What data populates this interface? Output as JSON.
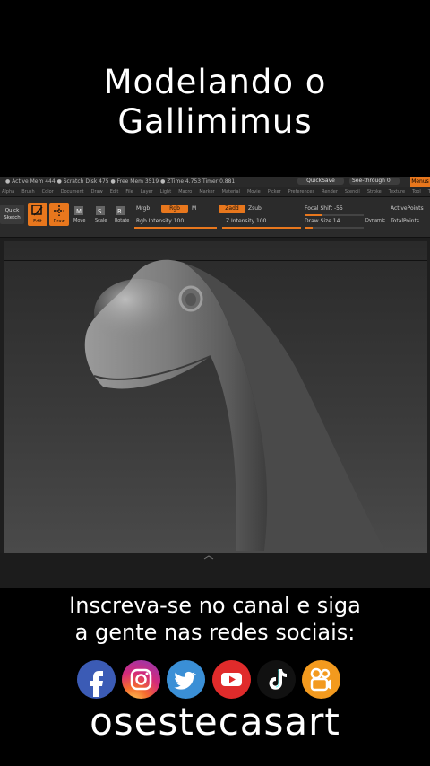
{
  "title": {
    "line1": "Modelando o",
    "line2": "Gallimimus"
  },
  "zbrush": {
    "status_info": "● Active Mem 444 ● Scratch Disk 475 ● Free Mem 3519 ● ZTime 4.753 Timer 0.881",
    "quicksave_label": "QuickSave",
    "seethrough_label": "See-through  0",
    "menus_label": "Menus",
    "menu_items": [
      "Alpha",
      "Brush",
      "Color",
      "Document",
      "Draw",
      "Edit",
      "File",
      "Layer",
      "Light",
      "Macro",
      "Marker",
      "Material",
      "Movie",
      "Picker",
      "Preferences",
      "Render",
      "Stencil",
      "Stroke",
      "Texture",
      "Tool",
      "Transform",
      "Zplugin",
      "Zscript"
    ],
    "quick_sketch_label": "Quick Sketch",
    "edit_label": "Edit",
    "draw_label": "Draw",
    "move_label": "Move",
    "scale_label": "Scale",
    "rotate_label": "Rotate",
    "mrgb_label": "Mrgb",
    "rgb_label": "Rgb",
    "m_label": "M",
    "zadd_label": "Zadd",
    "zsub_label": "Zsub",
    "rgb_intensity_label": "Rgb  Intensity 100",
    "z_intensity_label": "Z  Intensity 100",
    "focal_shift_label": "Focal  Shift -55",
    "draw_size_label": "Draw  Size 14",
    "dynamic_label": "Dynamic",
    "active_points_label": "ActivePoints",
    "total_points_label": "TotalPoints",
    "rgb_intensity": 100,
    "z_intensity": 100,
    "accent_color": "#e8771d"
  },
  "subtitle": {
    "line1": "Inscreva-se no canal e siga",
    "line2": "a gente nas redes sociais:"
  },
  "social_icons": [
    "facebook-icon",
    "instagram-icon",
    "twitter-icon",
    "youtube-icon",
    "tiktok-icon",
    "kwai-icon"
  ],
  "handle": "osestecasart"
}
